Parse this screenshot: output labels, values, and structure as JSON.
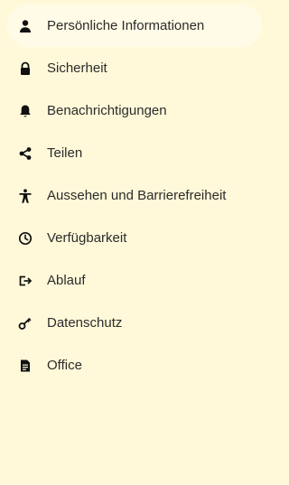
{
  "nav": {
    "items": [
      {
        "label": "Persönliche Informationen",
        "icon": "person-icon",
        "active": true
      },
      {
        "label": "Sicherheit",
        "icon": "lock-icon"
      },
      {
        "label": "Benachrichtigungen",
        "icon": "bell-icon"
      },
      {
        "label": "Teilen",
        "icon": "share-icon"
      },
      {
        "label": "Aussehen und Barrierefreiheit",
        "icon": "accessibility-icon"
      },
      {
        "label": "Verfügbarkeit",
        "icon": "clock-icon"
      },
      {
        "label": "Ablauf",
        "icon": "exit-icon"
      },
      {
        "label": "Datenschutz",
        "icon": "key-icon"
      },
      {
        "label": "Office",
        "icon": "document-icon"
      }
    ]
  },
  "colors": {
    "background": "#fff9d9",
    "active_item_background": "#fffbe6",
    "text": "#2b2b2b",
    "icon": "#111111"
  }
}
